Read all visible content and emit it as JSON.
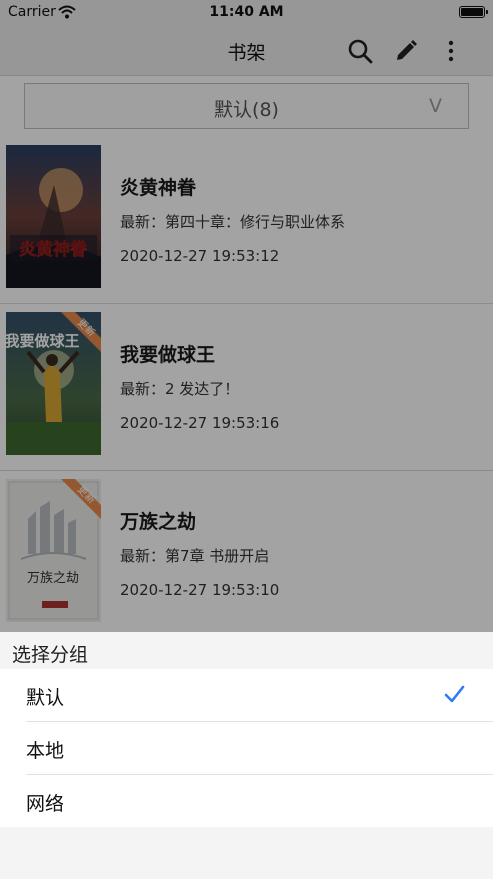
{
  "status_bar": {
    "carrier": "Carrier",
    "time": "11:40 AM"
  },
  "nav": {
    "title": "书架",
    "icons": [
      "search-icon",
      "pencil-icon",
      "more-vertical-icon"
    ]
  },
  "group_selector": {
    "label": "默认(8)",
    "chevron": "V"
  },
  "books": [
    {
      "title": "炎黄神眷",
      "latest": "最新：第四十章：修行与职业体系",
      "time": "2020-12-27 19:53:12",
      "cover_text": "炎黄神眷"
    },
    {
      "title": "我要做球王",
      "latest": "最新：2 发达了！",
      "time": "2020-12-27 19:53:16",
      "cover_text": "我要做球王",
      "badge": "更新"
    },
    {
      "title": "万族之劫",
      "latest": "最新：第7章 书册开启",
      "time": "2020-12-27 19:53:10",
      "cover_text": "万族之劫",
      "badge": "更新"
    }
  ],
  "sheet": {
    "title": "选择分组",
    "options": [
      {
        "label": "默认",
        "selected": true
      },
      {
        "label": "本地",
        "selected": false
      },
      {
        "label": "网络",
        "selected": false
      }
    ]
  },
  "colors": {
    "accent": "#2f7cf6",
    "badge": "#e8894a",
    "overlay": "rgba(0,0,0,0.36)"
  }
}
